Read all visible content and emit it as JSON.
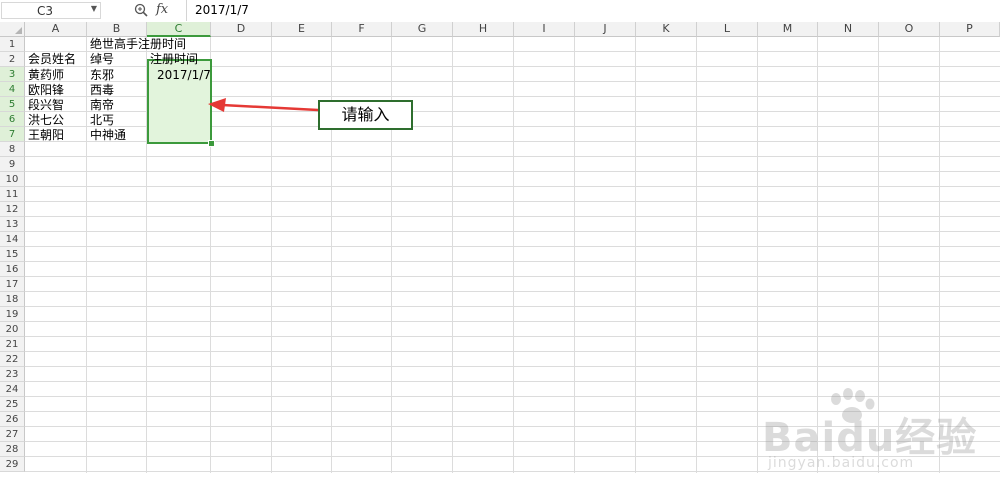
{
  "formula_bar": {
    "cell_reference": "C3",
    "fx_label": "fx",
    "formula_value": "2017/1/7"
  },
  "columns": [
    "A",
    "B",
    "C",
    "D",
    "E",
    "F",
    "G",
    "H",
    "I",
    "J",
    "K",
    "L",
    "M",
    "N",
    "O",
    "P"
  ],
  "rows": [
    "1",
    "2",
    "3",
    "4",
    "5",
    "6",
    "7",
    "8",
    "9",
    "10",
    "11",
    "12",
    "13",
    "14",
    "15",
    "16",
    "17",
    "18",
    "19",
    "20",
    "21",
    "22",
    "23",
    "24",
    "25",
    "26",
    "27",
    "28",
    "29"
  ],
  "active_column": "C",
  "active_rows": [
    "3",
    "4",
    "5",
    "6",
    "7"
  ],
  "cells": {
    "B1": "绝世高手注册时间",
    "A2": "会员姓名",
    "B2": "绰号",
    "C2": "注册时间",
    "A3": "黄药师",
    "B3": "东邪",
    "C3": "2017/1/7",
    "A4": "欧阳锋",
    "B4": "西毒",
    "A5": "段兴智",
    "B5": "南帝",
    "A6": "洪七公",
    "B6": "北丐",
    "A7": "王朝阳",
    "B7": "中神通"
  },
  "annotation": {
    "callout_text": "请输入",
    "arrow_color": "#e53935",
    "border_color": "#2e6e2e"
  },
  "watermark": {
    "brand": "Baidu经验",
    "domain": "jingyan.baidu.com"
  },
  "colors": {
    "selection_border": "#3c9a3c",
    "selection_fill": "#e2f4dc",
    "header_bg": "#f2f2f2"
  }
}
